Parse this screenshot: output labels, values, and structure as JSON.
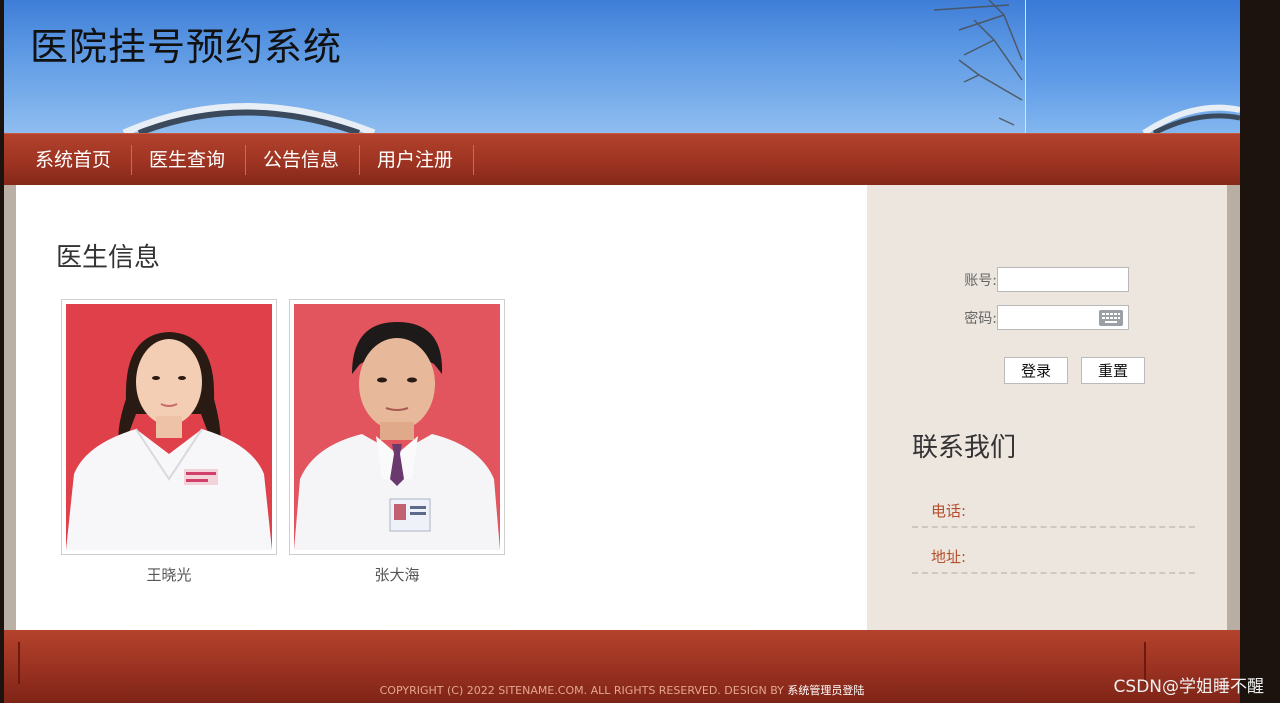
{
  "header": {
    "title": "医院挂号预约系统"
  },
  "nav": {
    "items": [
      {
        "label": "系统首页"
      },
      {
        "label": "医生查询"
      },
      {
        "label": "公告信息"
      },
      {
        "label": "用户注册"
      }
    ]
  },
  "main": {
    "section_title": "医生信息",
    "doctors": [
      {
        "name": "王晓光"
      },
      {
        "name": "张大海"
      }
    ]
  },
  "login": {
    "account_label": "账号:",
    "password_label": "密码:",
    "account_value": "",
    "password_value": "",
    "login_button": "登录",
    "reset_button": "重置"
  },
  "contact": {
    "title": "联系我们",
    "phone_label": "电话:",
    "address_label": "地址:"
  },
  "footer": {
    "copyright": "COPYRIGHT (C) 2022 SITENAME.COM. ALL RIGHTS RESERVED. DESIGN BY ",
    "admin_link": "系统管理员登陆"
  },
  "watermark": "CSDN@学姐睡不醒",
  "colors": {
    "nav_bg": "#9e3422",
    "sidebar_bg": "#ede6df",
    "contact_label": "#b5502e"
  }
}
